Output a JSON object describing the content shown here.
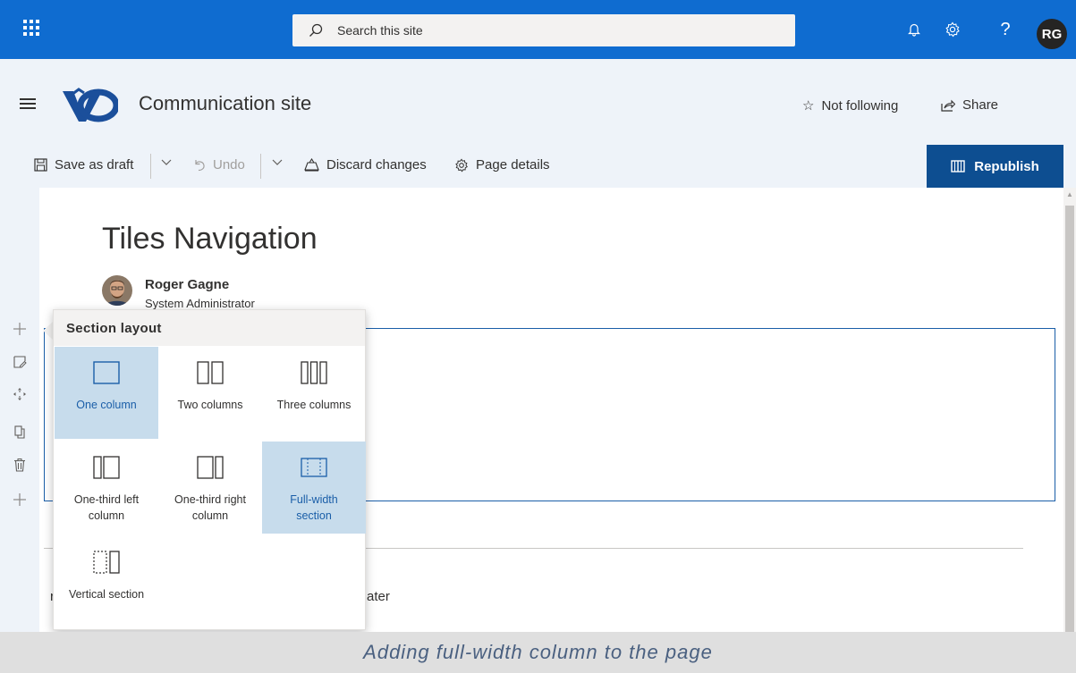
{
  "suitebar": {
    "search_placeholder": "Search this site",
    "avatar_initials": "RG",
    "help_glyph": "?",
    "color": "#0f6cd0"
  },
  "site": {
    "title": "Communication site",
    "follow_label": "Not following",
    "share_label": "Share"
  },
  "commandbar": {
    "save_draft": "Save as draft",
    "undo": "Undo",
    "discard": "Discard changes",
    "page_details": "Page details",
    "republish": "Republish",
    "republish_color": "#0d4e91"
  },
  "page": {
    "title": "Tiles Navigation",
    "author_name": "Roger Gagne",
    "author_role": "System Administrator",
    "partial_text": "ater",
    "partial_dot": "r"
  },
  "flyout": {
    "title": "Section layout",
    "options": [
      {
        "label": "One column",
        "icon": "one-column-icon",
        "selected": true
      },
      {
        "label": "Two columns",
        "icon": "two-columns-icon",
        "selected": false
      },
      {
        "label": "Three columns",
        "icon": "three-columns-icon",
        "selected": false
      },
      {
        "label": "One-third left column",
        "icon": "one-third-left-icon",
        "selected": false
      },
      {
        "label": "One-third right column",
        "icon": "one-third-right-icon",
        "selected": false
      },
      {
        "label": "Full-width section",
        "icon": "full-width-icon",
        "selected": true
      },
      {
        "label": "Vertical section",
        "icon": "vertical-section-icon",
        "selected": false
      }
    ],
    "selected_color": "#c7dcec"
  },
  "caption": "Adding full-width column to the page"
}
